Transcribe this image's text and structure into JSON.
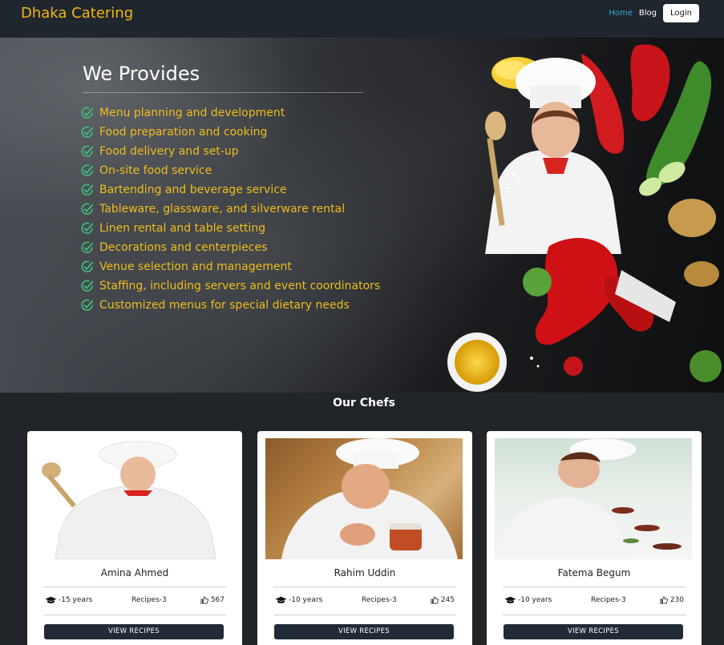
{
  "navbar": {
    "brand": "Dhaka Catering",
    "links": [
      {
        "label": "Home",
        "active": true
      },
      {
        "label": "Blog",
        "active": false
      }
    ],
    "login_label": "Login"
  },
  "hero": {
    "title": "We Provides",
    "check_icon": "check-circle-icon",
    "services": [
      "Menu planning and development",
      "Food preparation and cooking",
      "Food delivery and set-up",
      "On-site food service",
      "Bartending and beverage service",
      "Tableware, glassware, and silverware rental",
      "Linen rental and table setting",
      "Decorations and centerpieces",
      "Venue selection and management",
      "Staffing, including servers and event coordinators",
      "Customized menus for special dietary needs"
    ]
  },
  "chefs": {
    "title": "Our Chefs",
    "items": [
      {
        "name": "Amina Ahmed",
        "experience": "-15 years",
        "recipes": "Recipes-3",
        "likes": "567",
        "button": "VIEW RECIPES"
      },
      {
        "name": "Rahim Uddin",
        "experience": "-10 years",
        "recipes": "Recipes-3",
        "likes": "245",
        "button": "VIEW RECIPES"
      },
      {
        "name": "Fatema Begum",
        "experience": "-10 years",
        "recipes": "Recipes-3",
        "likes": "230",
        "button": "VIEW RECIPES"
      }
    ]
  },
  "colors": {
    "brand": "#f1b80f",
    "active_link": "#35a9d9",
    "service_text": "#f0bc1b",
    "check": "#3fbf7a",
    "page_bg": "#212529",
    "button_bg": "#212a36"
  },
  "icons": {
    "experience": "graduation-cap-icon",
    "likes": "thumbs-up-icon"
  }
}
